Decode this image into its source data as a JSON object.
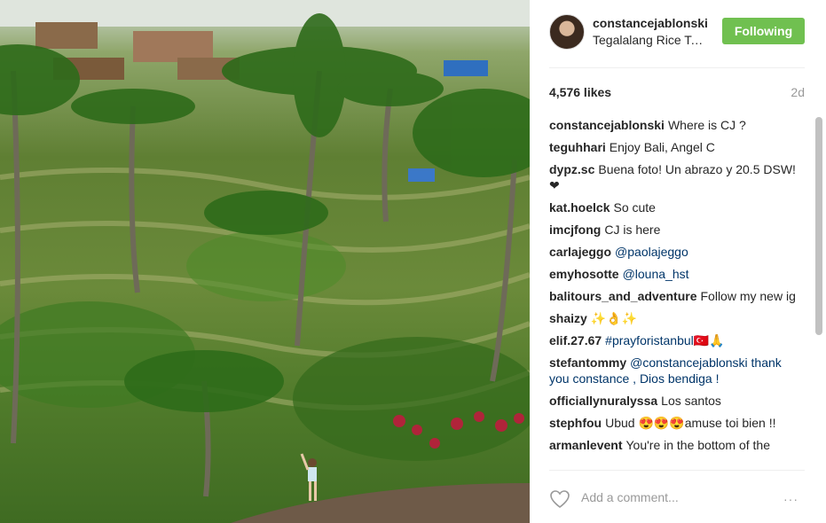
{
  "post": {
    "username": "constancejablonski",
    "location": "Tegalalang Rice Terrace",
    "follow_label": "Following",
    "likes": "4,576 likes",
    "time": "2d",
    "add_comment_placeholder": "Add a comment...",
    "more_icon": "···"
  },
  "comments": [
    {
      "user": "constancejablonski",
      "text": "Where is CJ ?"
    },
    {
      "user": "teguhhari",
      "text": "Enjoy Bali, Angel C"
    },
    {
      "user": "dypz.sc",
      "text": "Buena foto! Un abrazo y 20.5 DSW! ❤"
    },
    {
      "user": "kat.hoelck",
      "text": "So cute"
    },
    {
      "user": "imcjfong",
      "text": "CJ is here"
    },
    {
      "user": "carlajeggo",
      "text": "@paolajeggo"
    },
    {
      "user": "emyhosotte",
      "text": "@louna_hst"
    },
    {
      "user": "balitours_and_adventure",
      "text": "Follow my new ig"
    },
    {
      "user": "shaizy",
      "text": "✨👌✨"
    },
    {
      "user": "elif.27.67",
      "text": "#prayforistanbul🇹🇷🙏"
    },
    {
      "user": "stefantommy",
      "text": "@constancejablonski thank you constance , Dios bendiga !"
    },
    {
      "user": "officiallynuralyssa",
      "text": "Los santos"
    },
    {
      "user": "stephfou",
      "text": "Ubud 😍😍😍amuse toi bien !!"
    },
    {
      "user": "armanlevent",
      "text": "You're in the bottom of the"
    }
  ],
  "colors": {
    "follow_button": "#70c050",
    "link": "#003569",
    "muted": "#999999"
  },
  "icons": [
    "avatar",
    "heart-icon",
    "more-options-icon"
  ]
}
